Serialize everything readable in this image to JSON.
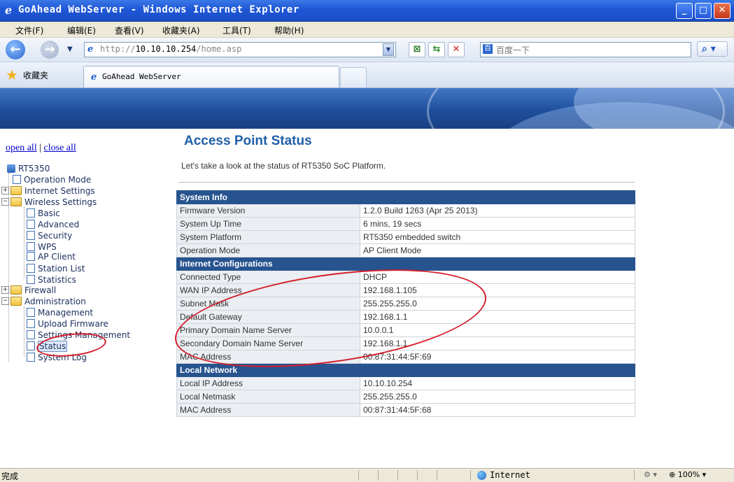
{
  "window": {
    "title": "GoAhead WebServer - Windows Internet Explorer"
  },
  "menu": [
    "文件(F)",
    "编辑(E)",
    "查看(V)",
    "收藏夹(A)",
    "工具(T)",
    "帮助(H)"
  ],
  "address": {
    "prefix": "http://",
    "host": "10.10.10.254",
    "path": "/home.asp"
  },
  "search": {
    "placeholder": "百度一下"
  },
  "favorites": {
    "label": "收藏夹"
  },
  "tab": {
    "title": "GoAhead WebServer"
  },
  "tree": {
    "open_all": "open all",
    "sep": "|",
    "close_all": "close all",
    "root": "RT5350",
    "operation_mode": "Operation Mode",
    "internet_settings": "Internet Settings",
    "wireless_settings": "Wireless Settings",
    "basic": "Basic",
    "advanced": "Advanced",
    "security": "Security",
    "wps": "WPS",
    "ap_client": "AP Client",
    "station_list": "Station List",
    "statistics": "Statistics",
    "firewall": "Firewall",
    "administration": "Administration",
    "management": "Management",
    "upload_firmware": "Upload Firmware",
    "settings_management": "Settings Management",
    "status": "Status",
    "system_log": "System Log"
  },
  "page": {
    "title": "Access Point Status",
    "description": "Let's take a look at the status of RT5350 SoC Platform."
  },
  "system_info": {
    "header": "System Info",
    "rows": [
      {
        "k": "Firmware Version",
        "v": "1.2.0 Build 1263 (Apr 25 2013)"
      },
      {
        "k": "System Up Time",
        "v": "6 mins, 19 secs"
      },
      {
        "k": "System Platform",
        "v": "RT5350 embedded switch"
      },
      {
        "k": "Operation Mode",
        "v": "AP Client Mode"
      }
    ]
  },
  "internet_config": {
    "header": "Internet Configurations",
    "rows": [
      {
        "k": "Connected Type",
        "v": "DHCP"
      },
      {
        "k": "WAN IP Address",
        "v": "192.168.1.105"
      },
      {
        "k": "Subnet Mask",
        "v": "255.255.255.0"
      },
      {
        "k": "Default Gateway",
        "v": "192.168.1.1"
      },
      {
        "k": "Primary Domain Name Server",
        "v": "10.0.0.1"
      },
      {
        "k": "Secondary Domain Name Server",
        "v": "192.168.1.1"
      },
      {
        "k": "MAC Address",
        "v": "00:87:31:44:5F:69"
      }
    ]
  },
  "local_network": {
    "header": "Local Network",
    "rows": [
      {
        "k": "Local IP Address",
        "v": "10.10.10.254"
      },
      {
        "k": "Local Netmask",
        "v": "255.255.255.0"
      },
      {
        "k": "MAC Address",
        "v": "00:87:31:44:5F:68"
      }
    ]
  },
  "statusbar": {
    "done": "完成",
    "zone": "Internet",
    "zoom": "100%"
  },
  "colors": {
    "section_header": "#27548f",
    "title_blue": "#1f5fa8",
    "annotation_red": "#d41d2a"
  }
}
